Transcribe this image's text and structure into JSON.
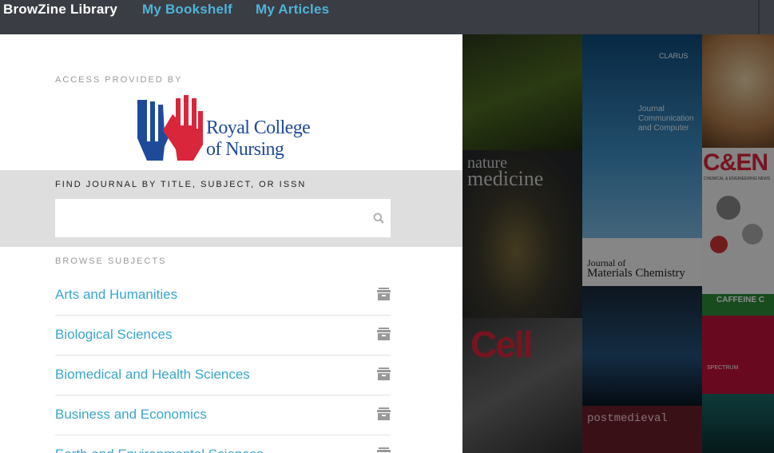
{
  "topbar": {
    "brand": "BrowZine Library",
    "nav": [
      {
        "label": "My Bookshelf"
      },
      {
        "label": "My Articles"
      }
    ]
  },
  "access": {
    "label": "ACCESS PROVIDED BY",
    "logo_line1": "Royal College",
    "logo_line2": "of Nursing"
  },
  "search": {
    "label": "FIND JOURNAL BY TITLE, SUBJECT, OR ISSN",
    "value": "",
    "placeholder": ""
  },
  "browse": {
    "label": "BROWSE SUBJECTS",
    "subjects": [
      {
        "label": "Arts and Humanities"
      },
      {
        "label": "Biological Sciences"
      },
      {
        "label": "Biomedical and Health Sciences"
      },
      {
        "label": "Business and Economics"
      },
      {
        "label": "Earth and Environmental Sciences"
      }
    ]
  },
  "covers": {
    "nature_line1": "nature",
    "nature_line2": "medicine",
    "cell": "Cell",
    "jmc_line1": "Journal of",
    "jmc_line2": "Materials Chemistry",
    "cen": "C&EN",
    "cen_sub": "CHEMICAL & ENGINEERING NEWS",
    "caffeine": "CAFFEINE C",
    "postmedieval": "postmedieval",
    "spectrum": "SPECTRUM",
    "comm_line1": "Journal",
    "comm_line2": "Communication",
    "comm_line3": "and Computer",
    "clarus": "CLARUS"
  },
  "colors": {
    "topbar_bg": "#3a3d44",
    "link": "#3aa6cc",
    "logo_blue": "#1f4a9a",
    "logo_red": "#d9263b"
  }
}
